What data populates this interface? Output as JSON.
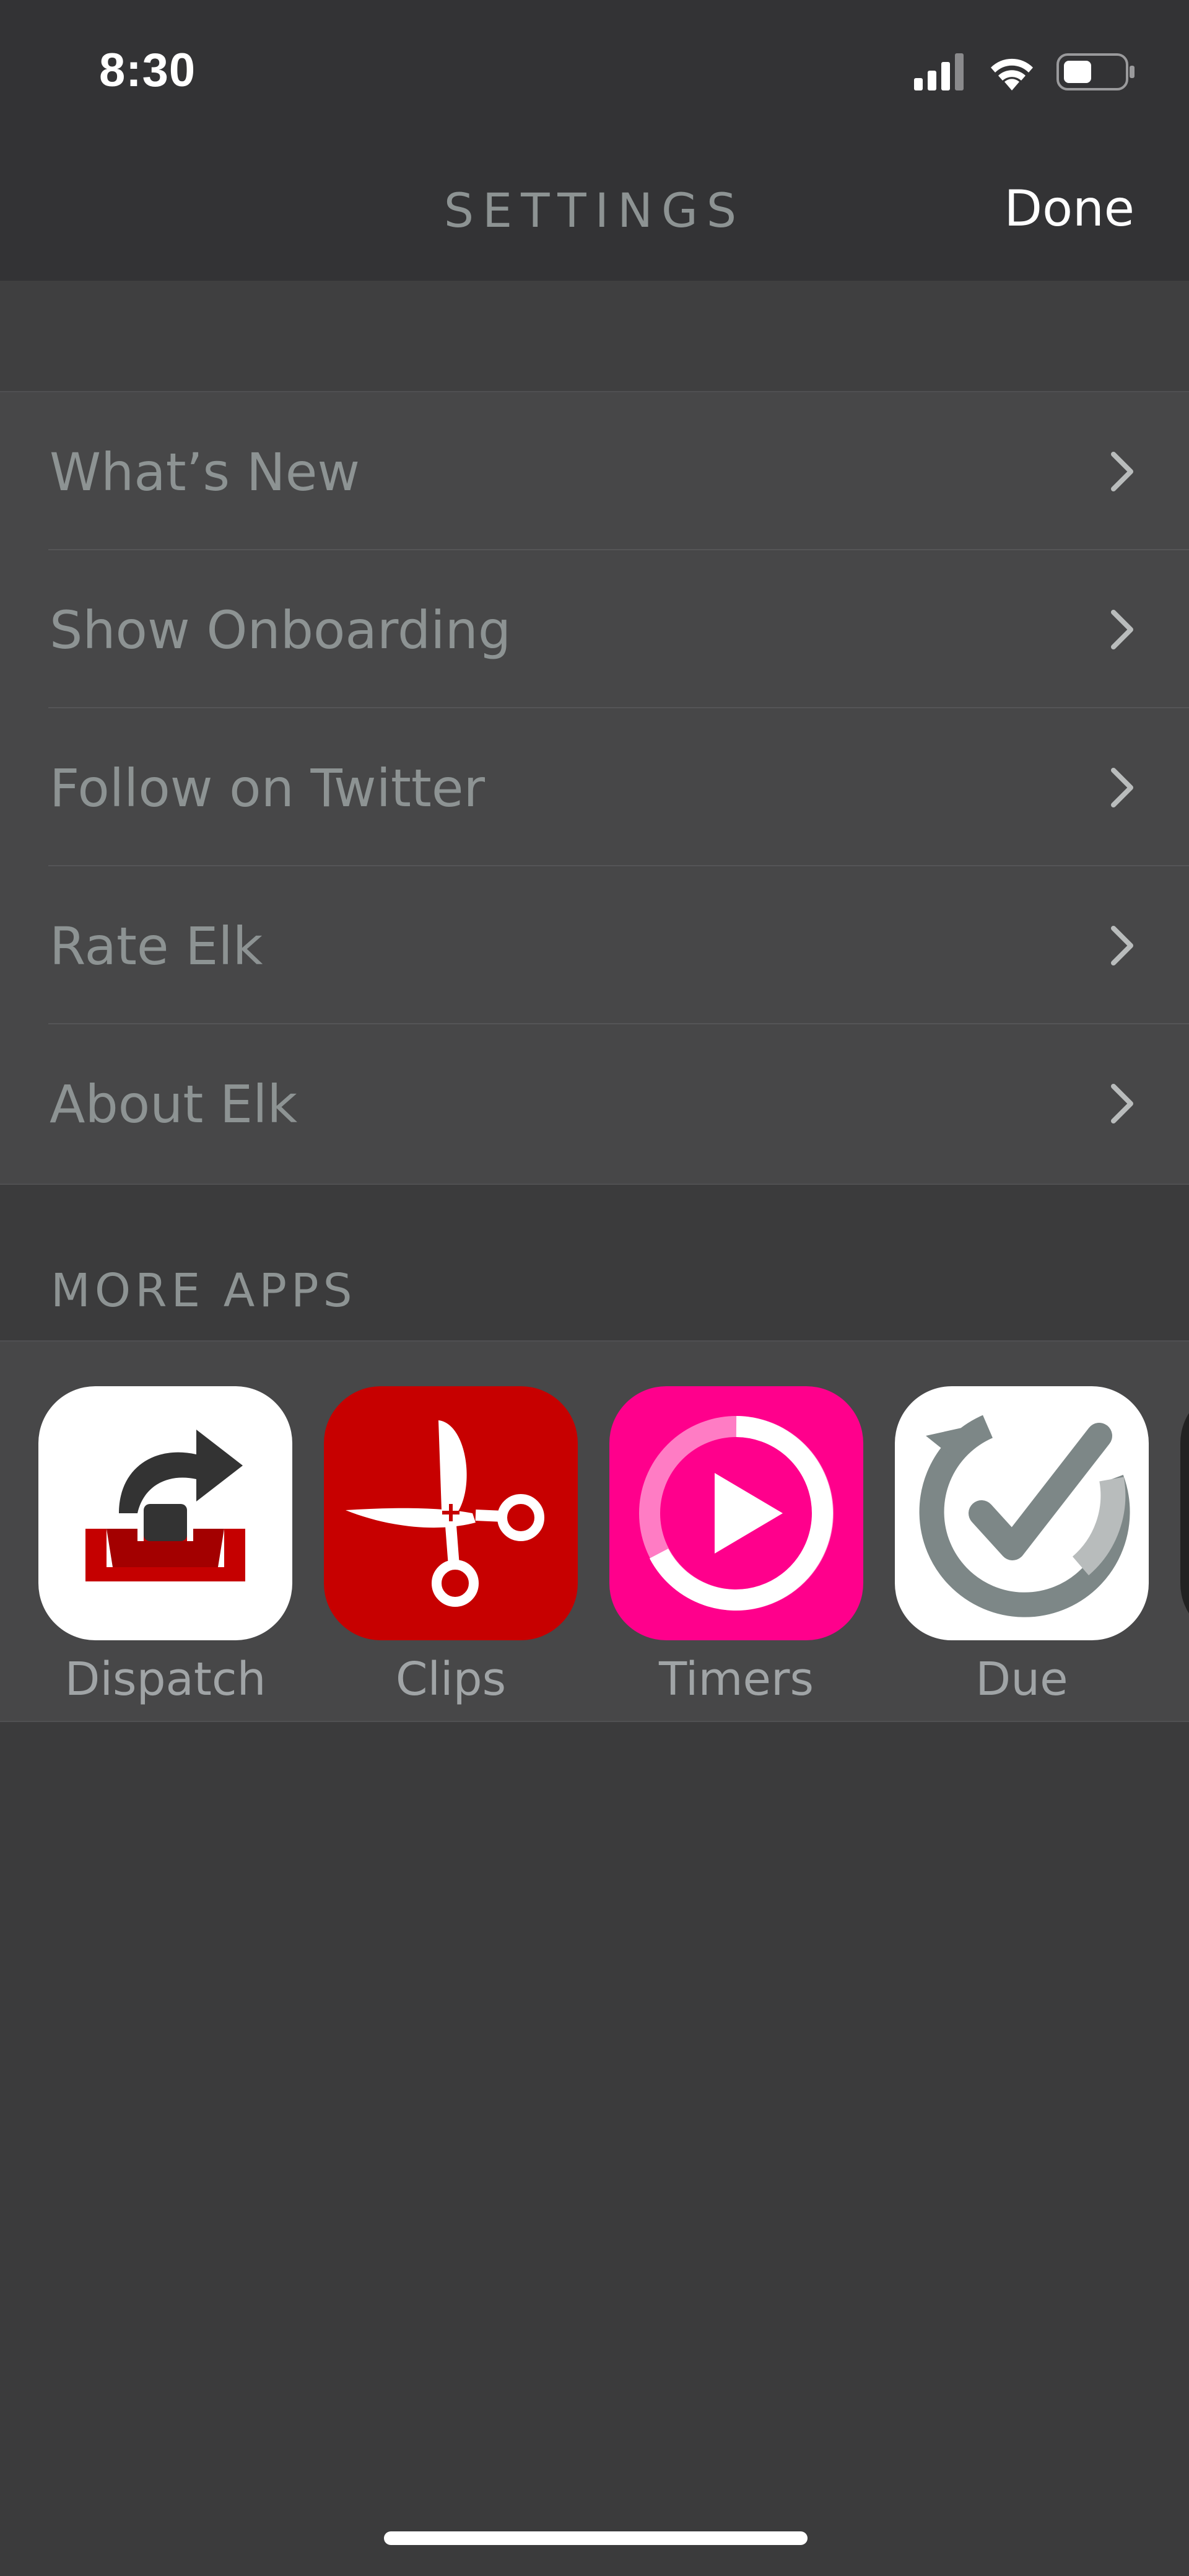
{
  "status_bar": {
    "time": "8:30"
  },
  "nav": {
    "title": "SETTINGS",
    "done_label": "Done"
  },
  "settings_items": [
    {
      "label": "What’s New"
    },
    {
      "label": "Show Onboarding"
    },
    {
      "label": "Follow on Twitter"
    },
    {
      "label": "Rate Elk"
    },
    {
      "label": "About Elk"
    }
  ],
  "more_apps": {
    "header": "MORE APPS",
    "apps": [
      {
        "name": "Dispatch",
        "icon": "dispatch-app-icon",
        "color": "#ffffff"
      },
      {
        "name": "Clips",
        "icon": "clips-app-icon",
        "color": "#c70000"
      },
      {
        "name": "Timers",
        "icon": "timers-app-icon",
        "color": "#ff008c"
      },
      {
        "name": "Due",
        "icon": "due-app-icon",
        "color": "#ffffff"
      }
    ]
  }
}
